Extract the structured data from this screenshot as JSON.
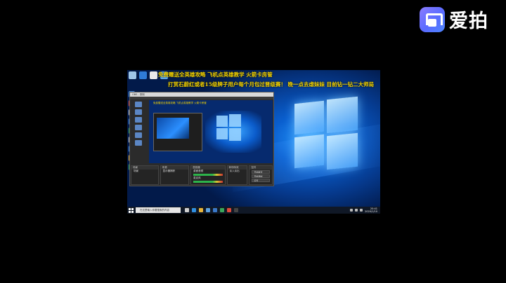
{
  "brand": {
    "name": "爱拍",
    "icon": "aipai-logo-icon"
  },
  "desktop": {
    "overlay_lines": [
      "免费赠送全英雄攻略 飞机点英雄教学 火箭卡房管",
      "打赏石蔚红或者15级牌子用户每个月包过晋级赛！ 晚一点去虐妹妹   目前钻一钻二大师局"
    ],
    "recording_window": {
      "title": "OBS - 录制",
      "nested_overlay": "免费赠送全英雄攻略 飞机点英雄教学 火箭卡房管",
      "docks": {
        "scenes": {
          "title": "场景",
          "items": [
            "场景"
          ]
        },
        "sources": {
          "title": "来源",
          "items": [
            "显示器捕获"
          ]
        },
        "mixer": {
          "title": "混音器",
          "items": [
            "桌面音频",
            "麦克风"
          ]
        },
        "transitions": {
          "title": "转场特效",
          "items": [
            "淡入淡出"
          ]
        },
        "controls": {
          "title": "控件",
          "items": [
            "开始推流",
            "开始录制",
            "设置",
            "退出"
          ]
        }
      }
    },
    "taskbar": {
      "search_placeholder": "在这里输入你要搜索的内容",
      "time": "20:41",
      "date": "2020/1/10"
    }
  },
  "colors": {
    "overlay_text": "#f5d400",
    "brand_gradient_start": "#8b7cff",
    "brand_gradient_end": "#4d86ff"
  }
}
